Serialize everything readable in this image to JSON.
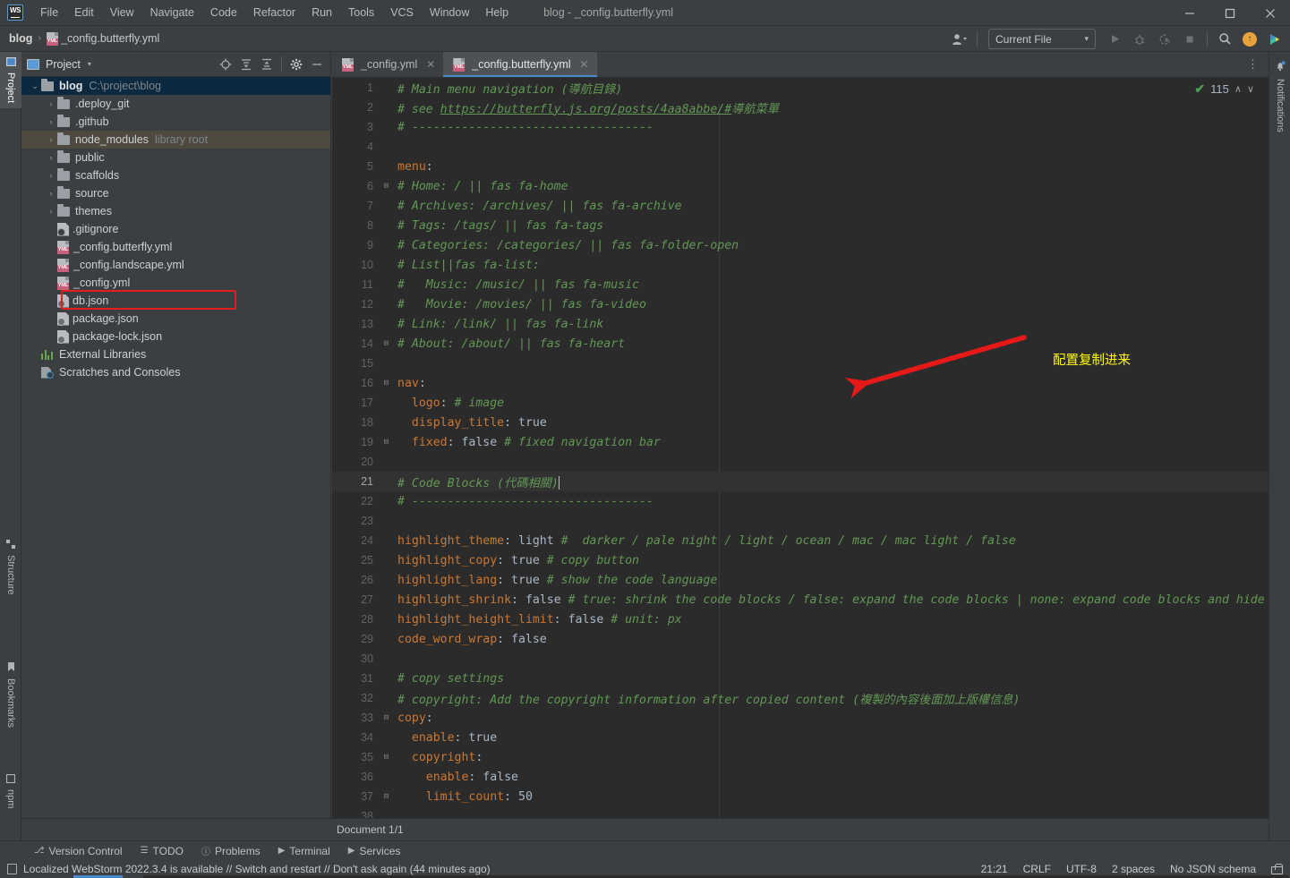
{
  "window": {
    "title": "blog - _config.butterfly.yml",
    "logo_text": "WS",
    "minimize": "—",
    "maximize": "☐",
    "close": "✕"
  },
  "menubar": [
    {
      "label": "File"
    },
    {
      "label": "Edit"
    },
    {
      "label": "View"
    },
    {
      "label": "Navigate"
    },
    {
      "label": "Code"
    },
    {
      "label": "Refactor"
    },
    {
      "label": "Run"
    },
    {
      "label": "Tools"
    },
    {
      "label": "VCS"
    },
    {
      "label": "Window"
    },
    {
      "label": "Help"
    }
  ],
  "breadcrumb": {
    "root": "blog",
    "separator": "›",
    "file": "_config.butterfly.yml"
  },
  "toolbar": {
    "run_config": "Current File",
    "run_config_caret": "▾",
    "account_caret": "▾",
    "run_icon": "▶",
    "debug_icon": "🐞",
    "run_coverage_icon": "↻",
    "stop_icon": "■",
    "search_icon": "⌕",
    "update_icon": "↑",
    "play_green_icon": "▶"
  },
  "left_toolwindows": [
    {
      "label": "Project",
      "active": true
    },
    {
      "label": "Structure",
      "active": false
    },
    {
      "label": "Bookmarks",
      "active": false
    },
    {
      "label": "npm",
      "active": false
    }
  ],
  "right_toolwindows": [
    {
      "label": "Notifications",
      "active": false
    }
  ],
  "project_panel": {
    "title": "Project",
    "caret": "▾",
    "actions": [
      {
        "name": "select-opened-file-icon",
        "glyph": "⊕"
      },
      {
        "name": "expand-all-icon",
        "glyph": "⩝"
      },
      {
        "name": "collapse-all-icon",
        "glyph": "⩞"
      },
      {
        "name": "settings-gear-icon",
        "glyph": "⚙"
      },
      {
        "name": "hide-panel-icon",
        "glyph": "—"
      }
    ],
    "tree": [
      {
        "label": "blog",
        "meta": "C:\\project\\blog",
        "type": "folder",
        "depth": 0,
        "arrow": "⌄",
        "bold": true,
        "selected": true
      },
      {
        "label": ".deploy_git",
        "meta": "",
        "type": "folder",
        "depth": 1,
        "arrow": "›"
      },
      {
        "label": ".github",
        "meta": "",
        "type": "folder",
        "depth": 1,
        "arrow": "›"
      },
      {
        "label": "node_modules",
        "meta": "library root",
        "type": "folder",
        "depth": 1,
        "arrow": "›",
        "highlight": true
      },
      {
        "label": "public",
        "meta": "",
        "type": "folder",
        "depth": 1,
        "arrow": "›"
      },
      {
        "label": "scaffolds",
        "meta": "",
        "type": "folder",
        "depth": 1,
        "arrow": "›"
      },
      {
        "label": "source",
        "meta": "",
        "type": "folder",
        "depth": 1,
        "arrow": "›"
      },
      {
        "label": "themes",
        "meta": "",
        "type": "folder",
        "depth": 1,
        "arrow": "›"
      },
      {
        "label": ".gitignore",
        "meta": "",
        "type": "gitignore",
        "depth": 1,
        "arrow": ""
      },
      {
        "label": "_config.butterfly.yml",
        "meta": "",
        "type": "yml",
        "depth": 1,
        "arrow": "",
        "boxed": true
      },
      {
        "label": "_config.landscape.yml",
        "meta": "",
        "type": "yml",
        "depth": 1,
        "arrow": ""
      },
      {
        "label": "_config.yml",
        "meta": "",
        "type": "yml",
        "depth": 1,
        "arrow": ""
      },
      {
        "label": "db.json",
        "meta": "",
        "type": "json",
        "depth": 1,
        "arrow": ""
      },
      {
        "label": "package.json",
        "meta": "",
        "type": "json",
        "depth": 1,
        "arrow": ""
      },
      {
        "label": "package-lock.json",
        "meta": "",
        "type": "json",
        "depth": 1,
        "arrow": ""
      },
      {
        "label": "External Libraries",
        "meta": "",
        "type": "lib",
        "depth": 0,
        "arrow": ""
      },
      {
        "label": "Scratches and Consoles",
        "meta": "",
        "type": "scratch",
        "depth": 0,
        "arrow": ""
      }
    ]
  },
  "editor": {
    "tabs": [
      {
        "label": "_config.yml",
        "active": false,
        "close": "✕"
      },
      {
        "label": "_config.butterfly.yml",
        "active": true,
        "close": "✕"
      }
    ],
    "more_tabs_icon": "⋮",
    "inspection": {
      "check": "✔",
      "count": "115",
      "up": "∧",
      "down": "∨"
    },
    "lines": [
      {
        "n": "1",
        "fold": "",
        "tokens": [
          {
            "t": "# Main menu navigation (導航目錄)",
            "c": "cm"
          }
        ]
      },
      {
        "n": "2",
        "fold": "",
        "tokens": [
          {
            "t": "# see ",
            "c": "cm"
          },
          {
            "t": "https://butterfly.js.org/posts/4aa8abbe/#",
            "c": "cm-link"
          },
          {
            "t": "導航菜單",
            "c": "cm"
          }
        ]
      },
      {
        "n": "3",
        "fold": "",
        "tokens": [
          {
            "t": "# ----------------------------------",
            "c": "cm"
          }
        ]
      },
      {
        "n": "4",
        "fold": "",
        "tokens": []
      },
      {
        "n": "5",
        "fold": "",
        "tokens": [
          {
            "t": "menu",
            "c": "key"
          },
          {
            "t": ":",
            "c": "punct"
          }
        ]
      },
      {
        "n": "6",
        "fold": "⊟",
        "tokens": [
          {
            "t": "# Home: / || fas fa-home",
            "c": "cm"
          }
        ]
      },
      {
        "n": "7",
        "fold": "",
        "tokens": [
          {
            "t": "# Archives: /archives/ || fas fa-archive",
            "c": "cm"
          }
        ]
      },
      {
        "n": "8",
        "fold": "",
        "tokens": [
          {
            "t": "# Tags: /tags/ || fas fa-tags",
            "c": "cm"
          }
        ]
      },
      {
        "n": "9",
        "fold": "",
        "tokens": [
          {
            "t": "# Categories: /categories/ || fas fa-folder-open",
            "c": "cm"
          }
        ]
      },
      {
        "n": "10",
        "fold": "",
        "tokens": [
          {
            "t": "# List||fas fa-list:",
            "c": "cm"
          }
        ]
      },
      {
        "n": "11",
        "fold": "",
        "tokens": [
          {
            "t": "#   Music: /music/ || fas fa-music",
            "c": "cm"
          }
        ]
      },
      {
        "n": "12",
        "fold": "",
        "tokens": [
          {
            "t": "#   Movie: /movies/ || fas fa-video",
            "c": "cm"
          }
        ]
      },
      {
        "n": "13",
        "fold": "",
        "tokens": [
          {
            "t": "# Link: /link/ || fas fa-link",
            "c": "cm"
          }
        ]
      },
      {
        "n": "14",
        "fold": "⊟",
        "tokens": [
          {
            "t": "# About: /about/ || fas fa-heart",
            "c": "cm"
          }
        ]
      },
      {
        "n": "15",
        "fold": "",
        "tokens": []
      },
      {
        "n": "16",
        "fold": "⊟",
        "tokens": [
          {
            "t": "nav",
            "c": "key"
          },
          {
            "t": ":",
            "c": "punct"
          }
        ]
      },
      {
        "n": "17",
        "fold": "",
        "tokens": [
          {
            "t": "  ",
            "c": "val"
          },
          {
            "t": "logo",
            "c": "key"
          },
          {
            "t": ": ",
            "c": "punct"
          },
          {
            "t": "# image",
            "c": "cm"
          }
        ]
      },
      {
        "n": "18",
        "fold": "",
        "tokens": [
          {
            "t": "  ",
            "c": "val"
          },
          {
            "t": "display_title",
            "c": "key"
          },
          {
            "t": ": ",
            "c": "punct"
          },
          {
            "t": "true",
            "c": "val"
          }
        ]
      },
      {
        "n": "19",
        "fold": "⊟",
        "tokens": [
          {
            "t": "  ",
            "c": "val"
          },
          {
            "t": "fixed",
            "c": "key"
          },
          {
            "t": ": ",
            "c": "punct"
          },
          {
            "t": "false ",
            "c": "val"
          },
          {
            "t": "# fixed navigation bar",
            "c": "cm"
          }
        ]
      },
      {
        "n": "20",
        "fold": "",
        "tokens": []
      },
      {
        "n": "21",
        "fold": "",
        "caret": true,
        "tokens": [
          {
            "t": "# Code Blocks (代碼相關)",
            "c": "cm"
          }
        ]
      },
      {
        "n": "22",
        "fold": "",
        "tokens": [
          {
            "t": "# ----------------------------------",
            "c": "cm"
          }
        ]
      },
      {
        "n": "23",
        "fold": "",
        "tokens": []
      },
      {
        "n": "24",
        "fold": "",
        "tokens": [
          {
            "t": "highlight_theme",
            "c": "key"
          },
          {
            "t": ": ",
            "c": "punct"
          },
          {
            "t": "light ",
            "c": "val"
          },
          {
            "t": "#  darker / pale night / light / ocean / mac / mac light / false",
            "c": "cm"
          }
        ]
      },
      {
        "n": "25",
        "fold": "",
        "tokens": [
          {
            "t": "highlight_copy",
            "c": "key"
          },
          {
            "t": ": ",
            "c": "punct"
          },
          {
            "t": "true ",
            "c": "val"
          },
          {
            "t": "# copy button",
            "c": "cm"
          }
        ]
      },
      {
        "n": "26",
        "fold": "",
        "tokens": [
          {
            "t": "highlight_lang",
            "c": "key"
          },
          {
            "t": ": ",
            "c": "punct"
          },
          {
            "t": "true ",
            "c": "val"
          },
          {
            "t": "# show the code language",
            "c": "cm"
          }
        ]
      },
      {
        "n": "27",
        "fold": "",
        "tokens": [
          {
            "t": "highlight_shrink",
            "c": "key"
          },
          {
            "t": ": ",
            "c": "punct"
          },
          {
            "t": "false ",
            "c": "val"
          },
          {
            "t": "# true: shrink the code blocks / false: expand the code blocks | none: expand code blocks and hide",
            "c": "cm"
          }
        ]
      },
      {
        "n": "28",
        "fold": "",
        "tokens": [
          {
            "t": "highlight_height_limit",
            "c": "key"
          },
          {
            "t": ": ",
            "c": "punct"
          },
          {
            "t": "false ",
            "c": "val"
          },
          {
            "t": "# unit: px",
            "c": "cm"
          }
        ]
      },
      {
        "n": "29",
        "fold": "",
        "tokens": [
          {
            "t": "code_word_wrap",
            "c": "key"
          },
          {
            "t": ": ",
            "c": "punct"
          },
          {
            "t": "false",
            "c": "val"
          }
        ]
      },
      {
        "n": "30",
        "fold": "",
        "tokens": []
      },
      {
        "n": "31",
        "fold": "",
        "tokens": [
          {
            "t": "# copy settings",
            "c": "cm"
          }
        ]
      },
      {
        "n": "32",
        "fold": "",
        "tokens": [
          {
            "t": "# copyright: Add the copyright information after copied content (複製的內容後面加上版權信息)",
            "c": "cm"
          }
        ]
      },
      {
        "n": "33",
        "fold": "⊟",
        "tokens": [
          {
            "t": "copy",
            "c": "key"
          },
          {
            "t": ":",
            "c": "punct"
          }
        ]
      },
      {
        "n": "34",
        "fold": "",
        "tokens": [
          {
            "t": "  ",
            "c": "val"
          },
          {
            "t": "enable",
            "c": "key"
          },
          {
            "t": ": ",
            "c": "punct"
          },
          {
            "t": "true",
            "c": "val"
          }
        ]
      },
      {
        "n": "35",
        "fold": "⊟",
        "tokens": [
          {
            "t": "  ",
            "c": "val"
          },
          {
            "t": "copyright",
            "c": "key"
          },
          {
            "t": ":",
            "c": "punct"
          }
        ]
      },
      {
        "n": "36",
        "fold": "",
        "tokens": [
          {
            "t": "    ",
            "c": "val"
          },
          {
            "t": "enable",
            "c": "key"
          },
          {
            "t": ": ",
            "c": "punct"
          },
          {
            "t": "false",
            "c": "val"
          }
        ]
      },
      {
        "n": "37",
        "fold": "⊟",
        "tokens": [
          {
            "t": "    ",
            "c": "val"
          },
          {
            "t": "limit_count",
            "c": "key"
          },
          {
            "t": ": ",
            "c": "punct"
          },
          {
            "t": "50",
            "c": "val"
          }
        ]
      },
      {
        "n": "38",
        "fold": "",
        "tokens": []
      }
    ]
  },
  "annotation": {
    "text": "配置复制进来",
    "color": "#ffff00",
    "arrow_color": "#e61919"
  },
  "document_bar": {
    "label": "Document 1/1"
  },
  "tool_windows_bottom": [
    {
      "label": "Version Control",
      "icon": "⎇"
    },
    {
      "label": "TODO",
      "icon": "☰"
    },
    {
      "label": "Problems",
      "icon": "ⓘ"
    },
    {
      "label": "Terminal",
      "icon": "▶"
    },
    {
      "label": "Services",
      "icon": "▶"
    }
  ],
  "statusbar": {
    "message": "Localized WebStorm 2022.3.4 is available // Switch and restart // Don't ask again (44 minutes ago)",
    "caret_position": "21:21",
    "line_separator": "CRLF",
    "encoding": "UTF-8",
    "indent": "2 spaces",
    "schema": "No JSON schema"
  },
  "colors": {
    "chrome": "#3c3f41",
    "editor_bg": "#2b2b2b",
    "accent_blue": "#4a88c7",
    "comment_green": "#629755",
    "key_orange": "#cc7832",
    "text": "#a9b7c6",
    "selection_navy": "#0d293f",
    "highlight_row": "#4e4a3f",
    "annotation_red": "#e61919",
    "annotation_yellow": "#ffff00"
  }
}
